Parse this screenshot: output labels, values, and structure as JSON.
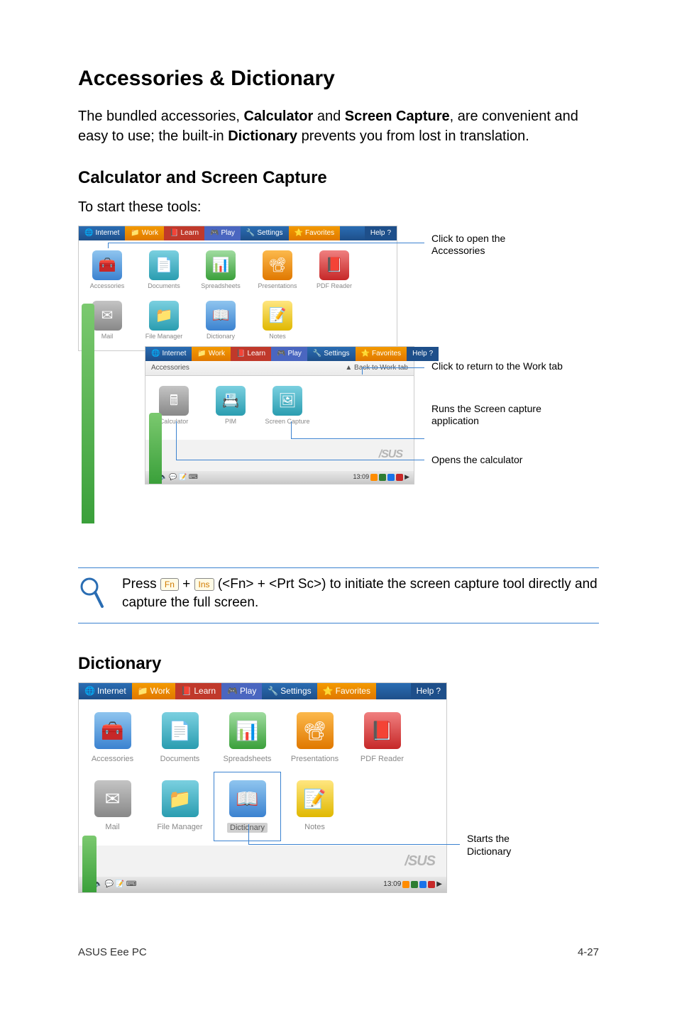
{
  "title": "Accessories & Dictionary",
  "intro_parts": {
    "p1": "The bundled accessories, ",
    "b1": "Calculator",
    "p2": " and ",
    "b2": "Screen Capture",
    "p3": ", are convenient and easy to use; the built-in ",
    "b3": "Dictionary",
    "p4": " prevents you from lost in translation."
  },
  "section_calc": "Calculator and Screen Capture",
  "calc_sub": "To start these tools:",
  "section_dict": "Dictionary",
  "tabs": {
    "internet": "Internet",
    "work": "Work",
    "learn": "Learn",
    "play": "Play",
    "settings": "Settings",
    "favorites": "Favorites",
    "help": "Help"
  },
  "breadcrumb_label": "Accessories",
  "breadcrumb_back": "Back to Work tab",
  "apps": {
    "accessories": "Accessories",
    "documents": "Documents",
    "spreadsheets": "Spreadsheets",
    "presentations": "Presentations",
    "pdf_reader": "PDF Reader",
    "mail": "Mail",
    "file_manager": "File Manager",
    "dictionary": "Dictionary",
    "notes": "Notes",
    "calculator": "Calculator",
    "pim": "PIM",
    "screen_capture": "Screen Capture"
  },
  "brand": "/SUS",
  "clock": "13:09",
  "callouts": {
    "open_accessories": "Click to open the Accessories",
    "return_work": "Click to return to the Work tab",
    "runs_screen": "Runs the Screen capture application",
    "opens_calc": "Opens the calculator",
    "starts_dict": "Starts the Dictionary"
  },
  "note": {
    "pre": "Press ",
    "key1": "Fn",
    "plus": " + ",
    "key2": "Ins",
    "mid": " (<Fn> + <Prt Sc>) to initiate the screen capture tool directly and capture the full screen."
  },
  "footer_left": "ASUS Eee PC",
  "footer_right": "4-27"
}
